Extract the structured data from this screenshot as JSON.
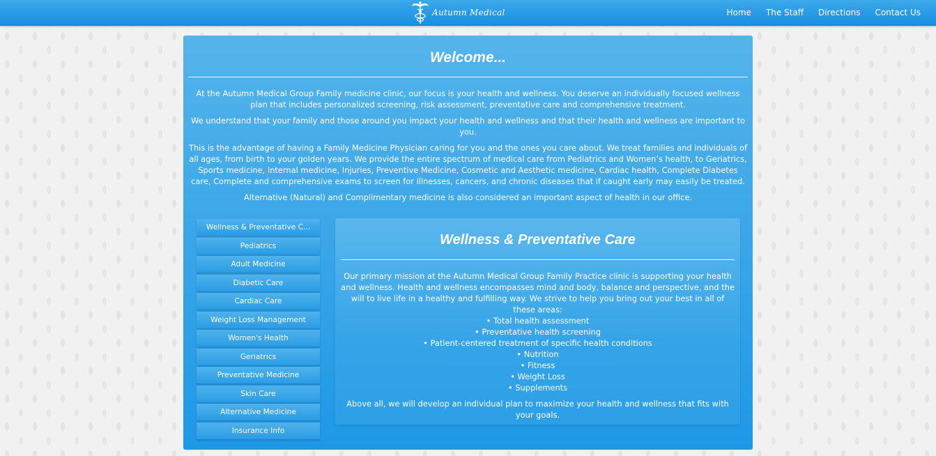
{
  "header": {
    "logo_text": "Autumn Medical",
    "nav": [
      "Home",
      "The Staff",
      "Directions",
      "Contact Us"
    ]
  },
  "welcome": {
    "title": "Welcome...",
    "paragraphs": [
      "At the Autumn Medical Group Family medicine clinic, our focus is your health and wellness. You deserve an individually focused wellness plan that includes personalized screening, risk assessment, preventative care and comprehensive treatment.",
      "We understand that your family and those around you impact your health and wellness and that their health and wellness are important to you.",
      "This is the advantage of having a Family Medicine Physician caring for you and the ones you care about. We treat families and individuals of all ages, from birth to your golden years. We provide the entire spectrum of medical care from Pediatrics and Women’s health, to Geriatrics, Sports medicine, Internal medicine, Injuries, Preventive Medicine, Cosmetic and Aesthetic medicine, Cardiac health, Complete Diabetes care, Complete and comprehensive exams to screen for illnesses, cancers, and chronic diseases that if caught early may easily be treated.",
      "Alternative (Natural) and Complimentary medicine is also considered an important aspect of health in our office."
    ]
  },
  "sidebar": {
    "items": [
      "Wellness & Preventative C...",
      "Pediatrics",
      "Adult Medicine",
      "Diabetic Care",
      "Cardiac Care",
      "Weight Loss Management",
      "Women's Health",
      "Geriatrics",
      "Preventative Medicine",
      "Skin Care",
      "Alternative Medicine",
      "Insurance Info"
    ]
  },
  "panel": {
    "title": "Wellness & Preventative Care",
    "intro": "Our primary mission at the Autumn Medical Group Family Practice clinic is supporting your health and wellness. Health and wellness encompasses mind and body, balance and perspective, and the will to live life in a healthy and fulfilling way. We strive to help you bring out your best in all of these areas:",
    "bullets": [
      "• Total health assessment",
      "• Preventative health screening",
      "• Patient-centered treatment of specific health conditions",
      "• Nutrition",
      "• Fitness",
      "• Weight Loss",
      "• Supplements"
    ],
    "closing": "Above all, we will develop an individual plan to maximize your health and wellness that fits with your goals."
  }
}
